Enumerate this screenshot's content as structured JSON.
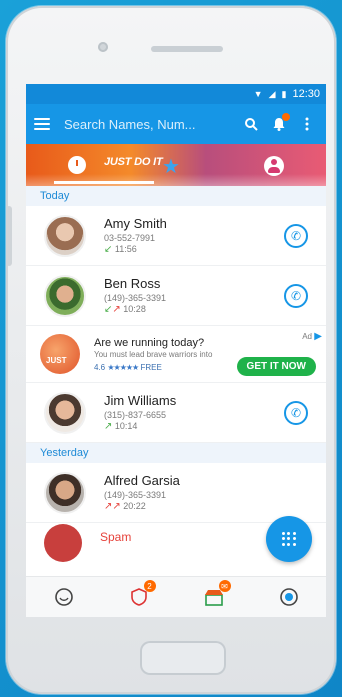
{
  "status_bar": {
    "time": "12:30"
  },
  "app_bar": {
    "search_placeholder": "Search Names, Num..."
  },
  "banner": {
    "brand_text": "JUST DO IT"
  },
  "sections": {
    "today": "Today",
    "yesterday": "Yesterday"
  },
  "calls": [
    {
      "name": "Amy Smith",
      "number": "03-552-7991",
      "time": "11:56",
      "direction": "in"
    },
    {
      "name": "Ben Ross",
      "number": "(149)-365-3391",
      "time": "10:28",
      "direction": "mixed"
    },
    {
      "name": "Jim Williams",
      "number": "(315)-837-6655",
      "time": "10:14",
      "direction": "out"
    },
    {
      "name": "Alfred Garsia",
      "number": "(149)-365-3391",
      "time": "20:22",
      "direction": "out"
    }
  ],
  "ad": {
    "title": "Are we running today?",
    "subtitle": "You must lead brave warriors into",
    "rating": "4.6",
    "stars": "★★★★★",
    "price": "FREE",
    "label": "Ad",
    "cta": "GET IT NOW",
    "image_text": "JUST"
  },
  "spam": {
    "label": "Spam"
  },
  "bottom_nav": {
    "block_badge": "2"
  },
  "colors": {
    "primary": "#1696e6",
    "accent": "#ff6a00",
    "cta": "#1fb24a",
    "spam": "#e6423b"
  }
}
